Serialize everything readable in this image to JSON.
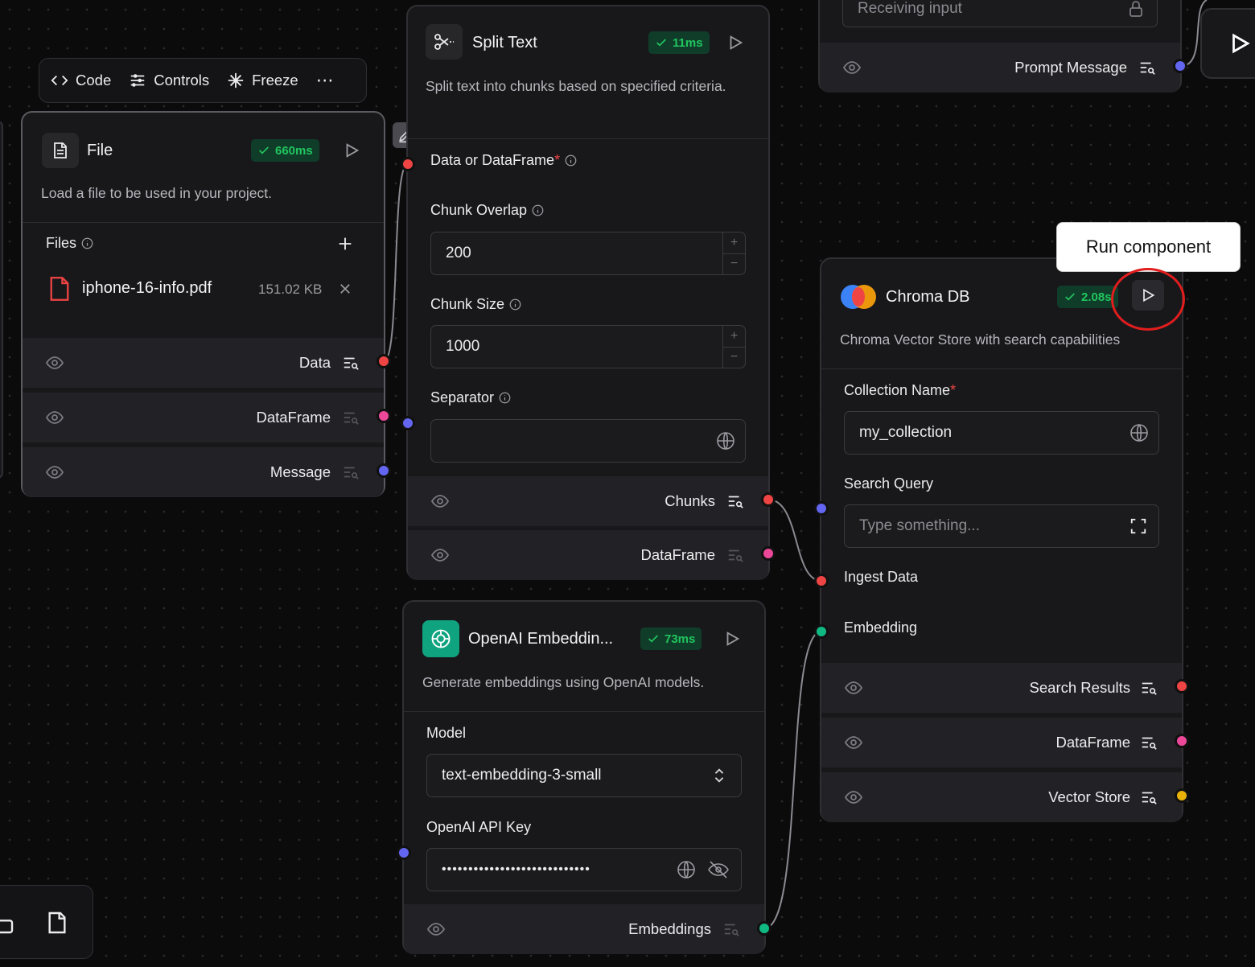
{
  "toolbar": {
    "code_label": "Code",
    "controls_label": "Controls",
    "freeze_label": "Freeze",
    "more_label": "⋯"
  },
  "file_node": {
    "title": "File",
    "badge": "660ms",
    "description": "Load a file to be used in your project.",
    "files_label": "Files",
    "file_name": "iphone-16-info.pdf",
    "file_size": "151.02 KB",
    "outputs": [
      "Data",
      "DataFrame",
      "Message"
    ]
  },
  "split_node": {
    "title": "Split Text",
    "badge": "11ms",
    "description": "Split text into chunks based on specified criteria.",
    "data_label": "Data or DataFrame",
    "chunk_overlap_label": "Chunk Overlap",
    "chunk_overlap_value": "200",
    "chunk_size_label": "Chunk Size",
    "chunk_size_value": "1000",
    "separator_label": "Separator",
    "separator_value": "",
    "outputs": [
      "Chunks",
      "DataFrame"
    ]
  },
  "openai_node": {
    "title": "OpenAI Embeddin...",
    "badge": "73ms",
    "description": "Generate embeddings using OpenAI models.",
    "model_label": "Model",
    "model_value": "text-embedding-3-small",
    "api_key_label": "OpenAI API Key",
    "api_key_value": "••••••••••••••••••••••••••••",
    "outputs": [
      "Embeddings"
    ]
  },
  "chroma_node": {
    "title": "Chroma DB",
    "badge": "2.08s",
    "description": "Chroma Vector Store with search capabilities",
    "collection_label": "Collection Name",
    "collection_value": "my_collection",
    "search_label": "Search Query",
    "search_placeholder": "Type something...",
    "ingest_label": "Ingest Data",
    "embedding_label": "Embedding",
    "outputs": [
      "Search Results",
      "DataFrame",
      "Vector Store"
    ]
  },
  "prompt_node": {
    "input_placeholder": "Receiving input",
    "output_label": "Prompt Message"
  },
  "tooltip": {
    "text": "Run component"
  },
  "colors": {
    "handle_red": "#ef4444",
    "handle_blue": "#6366f1",
    "handle_pink": "#ec4899",
    "handle_green": "#10b981",
    "handle_yellow": "#eab308",
    "badge_green": "#22c55e"
  }
}
